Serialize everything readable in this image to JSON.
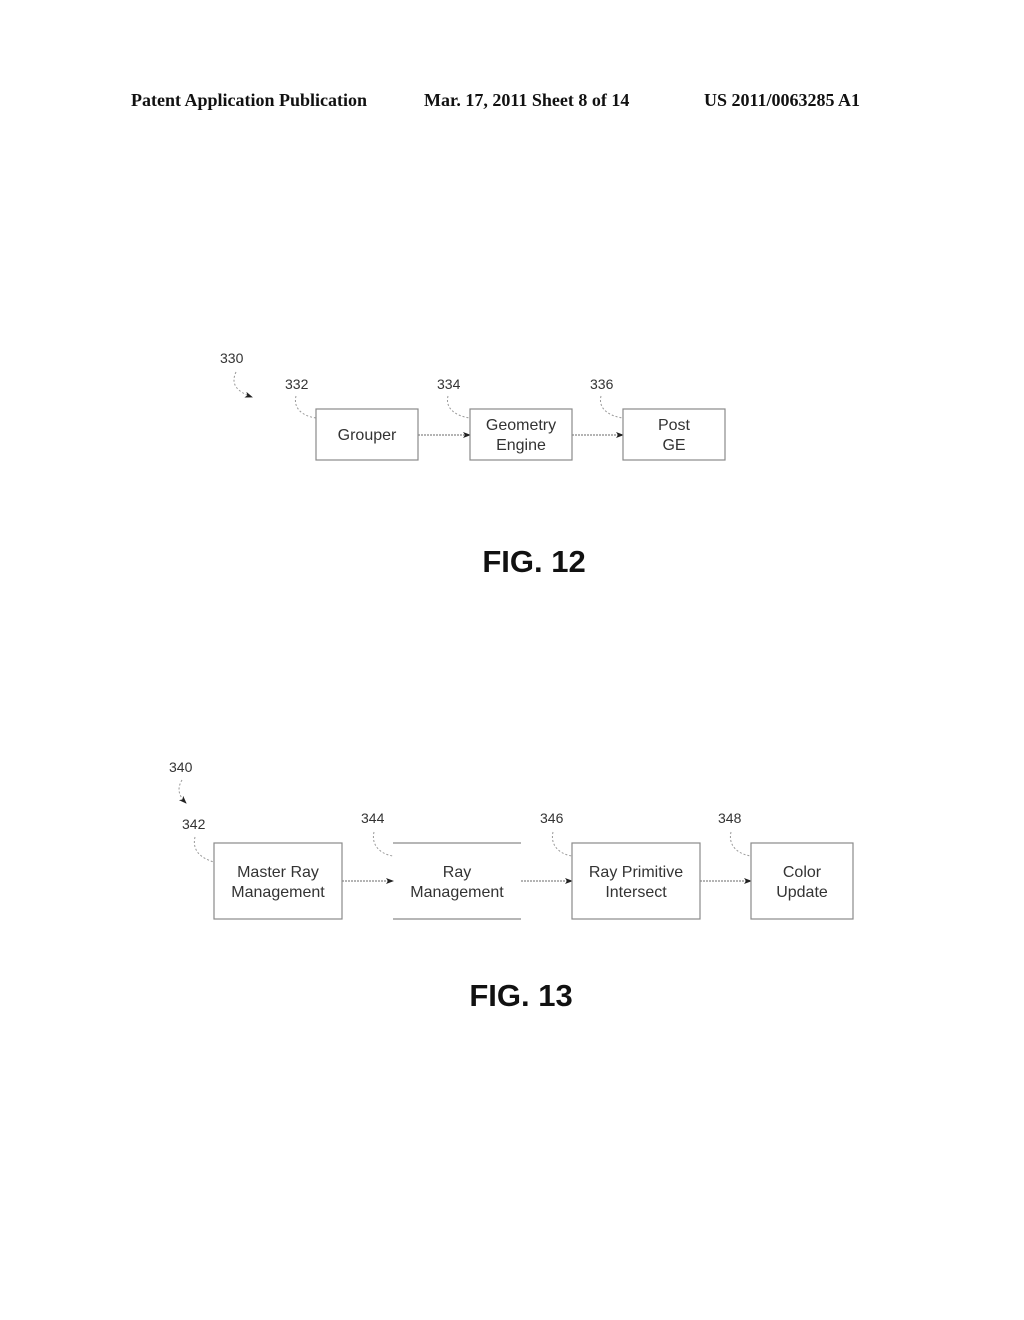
{
  "header": {
    "left": "Patent Application Publication",
    "center": "Mar. 17, 2011  Sheet 8 of 14",
    "right": "US 2011/0063285 A1"
  },
  "fig12": {
    "ref": "330",
    "label": "FIG. 12",
    "blocks": [
      {
        "ref": "332",
        "lines": [
          "Grouper"
        ]
      },
      {
        "ref": "334",
        "lines": [
          "Geometry",
          "Engine"
        ]
      },
      {
        "ref": "336",
        "lines": [
          "Post",
          "GE"
        ]
      }
    ]
  },
  "fig13": {
    "ref": "340",
    "label": "FIG. 13",
    "blocks": [
      {
        "ref": "342",
        "lines": [
          "Master Ray",
          "Management"
        ]
      },
      {
        "ref": "344",
        "lines": [
          "Ray",
          "Management"
        ]
      },
      {
        "ref": "346",
        "lines": [
          "Ray Primitive",
          "Intersect"
        ]
      },
      {
        "ref": "348",
        "lines": [
          "Color",
          "Update"
        ]
      }
    ]
  }
}
